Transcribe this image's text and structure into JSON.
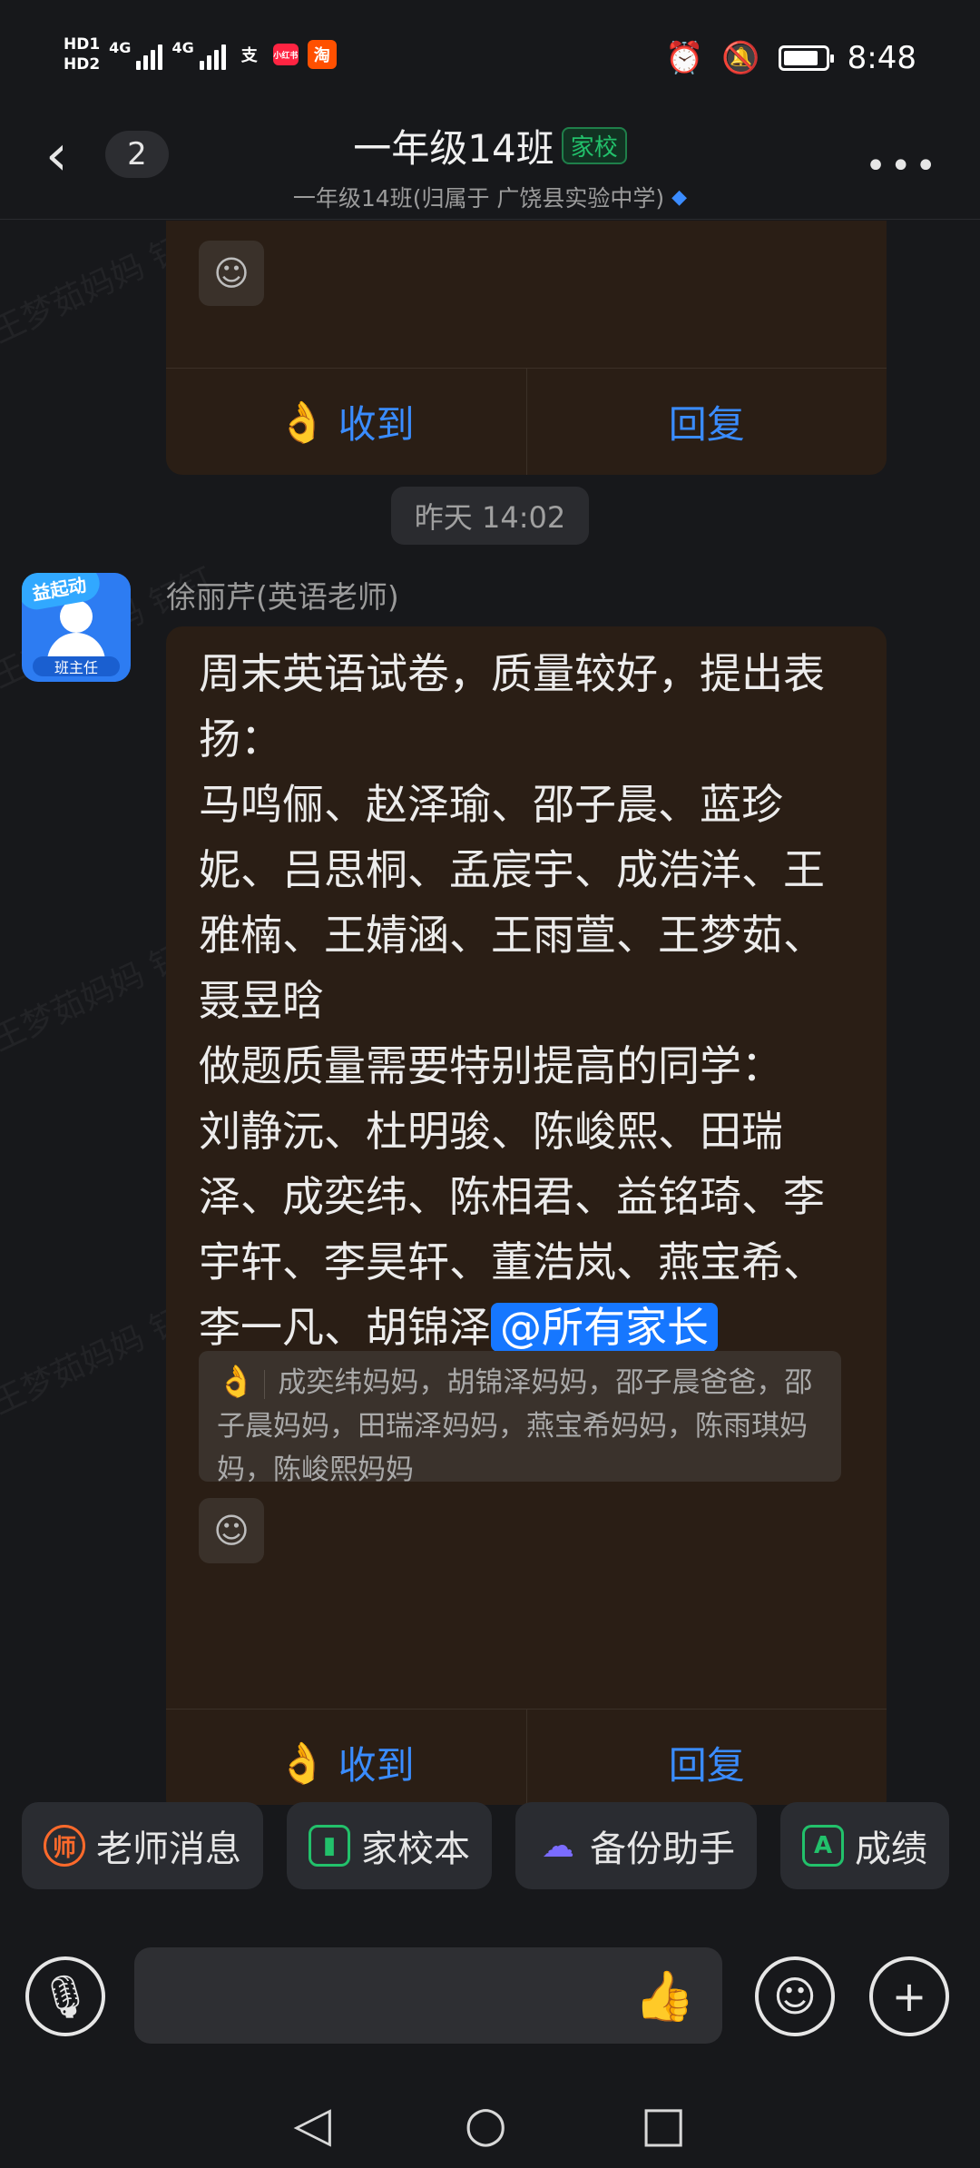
{
  "status_bar": {
    "hd1": "HD1",
    "hd2": "HD2",
    "net1": "4G",
    "net2": "4G",
    "app_icons": [
      "支",
      "小红书",
      "淘"
    ],
    "time": "8:48",
    "battery_percent": 85
  },
  "header": {
    "back_icon": "back-chevron-icon",
    "unread_count": "2",
    "title": "一年级14班",
    "tag": "家校",
    "subtitle": "一年级14班(归属于 广饶县实验中学)",
    "more_icon": "more-icon"
  },
  "previous_card": {
    "ack_label": "收到",
    "reply_label": "回复"
  },
  "time_divider": "昨天 14:02",
  "message": {
    "avatar_badge": "益起动",
    "avatar_role": "班主任",
    "sender": "徐丽芹(英语老师)",
    "text": "周末英语试卷，质量较好，提出表扬：\n马鸣俪、赵泽瑜、邵子晨、蓝珍妮、吕思桐、孟宸宇、成浩洋、王雅楠、王婧涵、王雨萱、王梦茹、聂昱晗\n做题质量需要特别提高的同学：\n刘静沅、杜明骏、陈峻熙、田瑞泽、成奕纬、陈相君、益铭琦、李宇轩、李昊轩、董浩岚、燕宝希、李一凡、胡锦泽",
    "mention": "@所有家长",
    "acknowledged_by": "成奕纬妈妈，胡锦泽妈妈，邵子晨爸爸，邵子晨妈妈，田瑞泽妈妈，燕宝希妈妈，陈雨琪妈妈，陈峻熙妈妈",
    "ack_label": "收到",
    "reply_label": "回复"
  },
  "shortcuts": [
    {
      "label": "老师消息",
      "icon_char": "师",
      "color": "#ff6a2b"
    },
    {
      "label": "家校本",
      "icon_char": "▮",
      "color": "#22c16b"
    },
    {
      "label": "备份助手",
      "icon_char": "☁",
      "color": "#7b6cff"
    },
    {
      "label": "成绩",
      "icon_char": "A",
      "color": "#22c16b"
    }
  ],
  "watermark": "王梦茹妈妈 钉钉"
}
